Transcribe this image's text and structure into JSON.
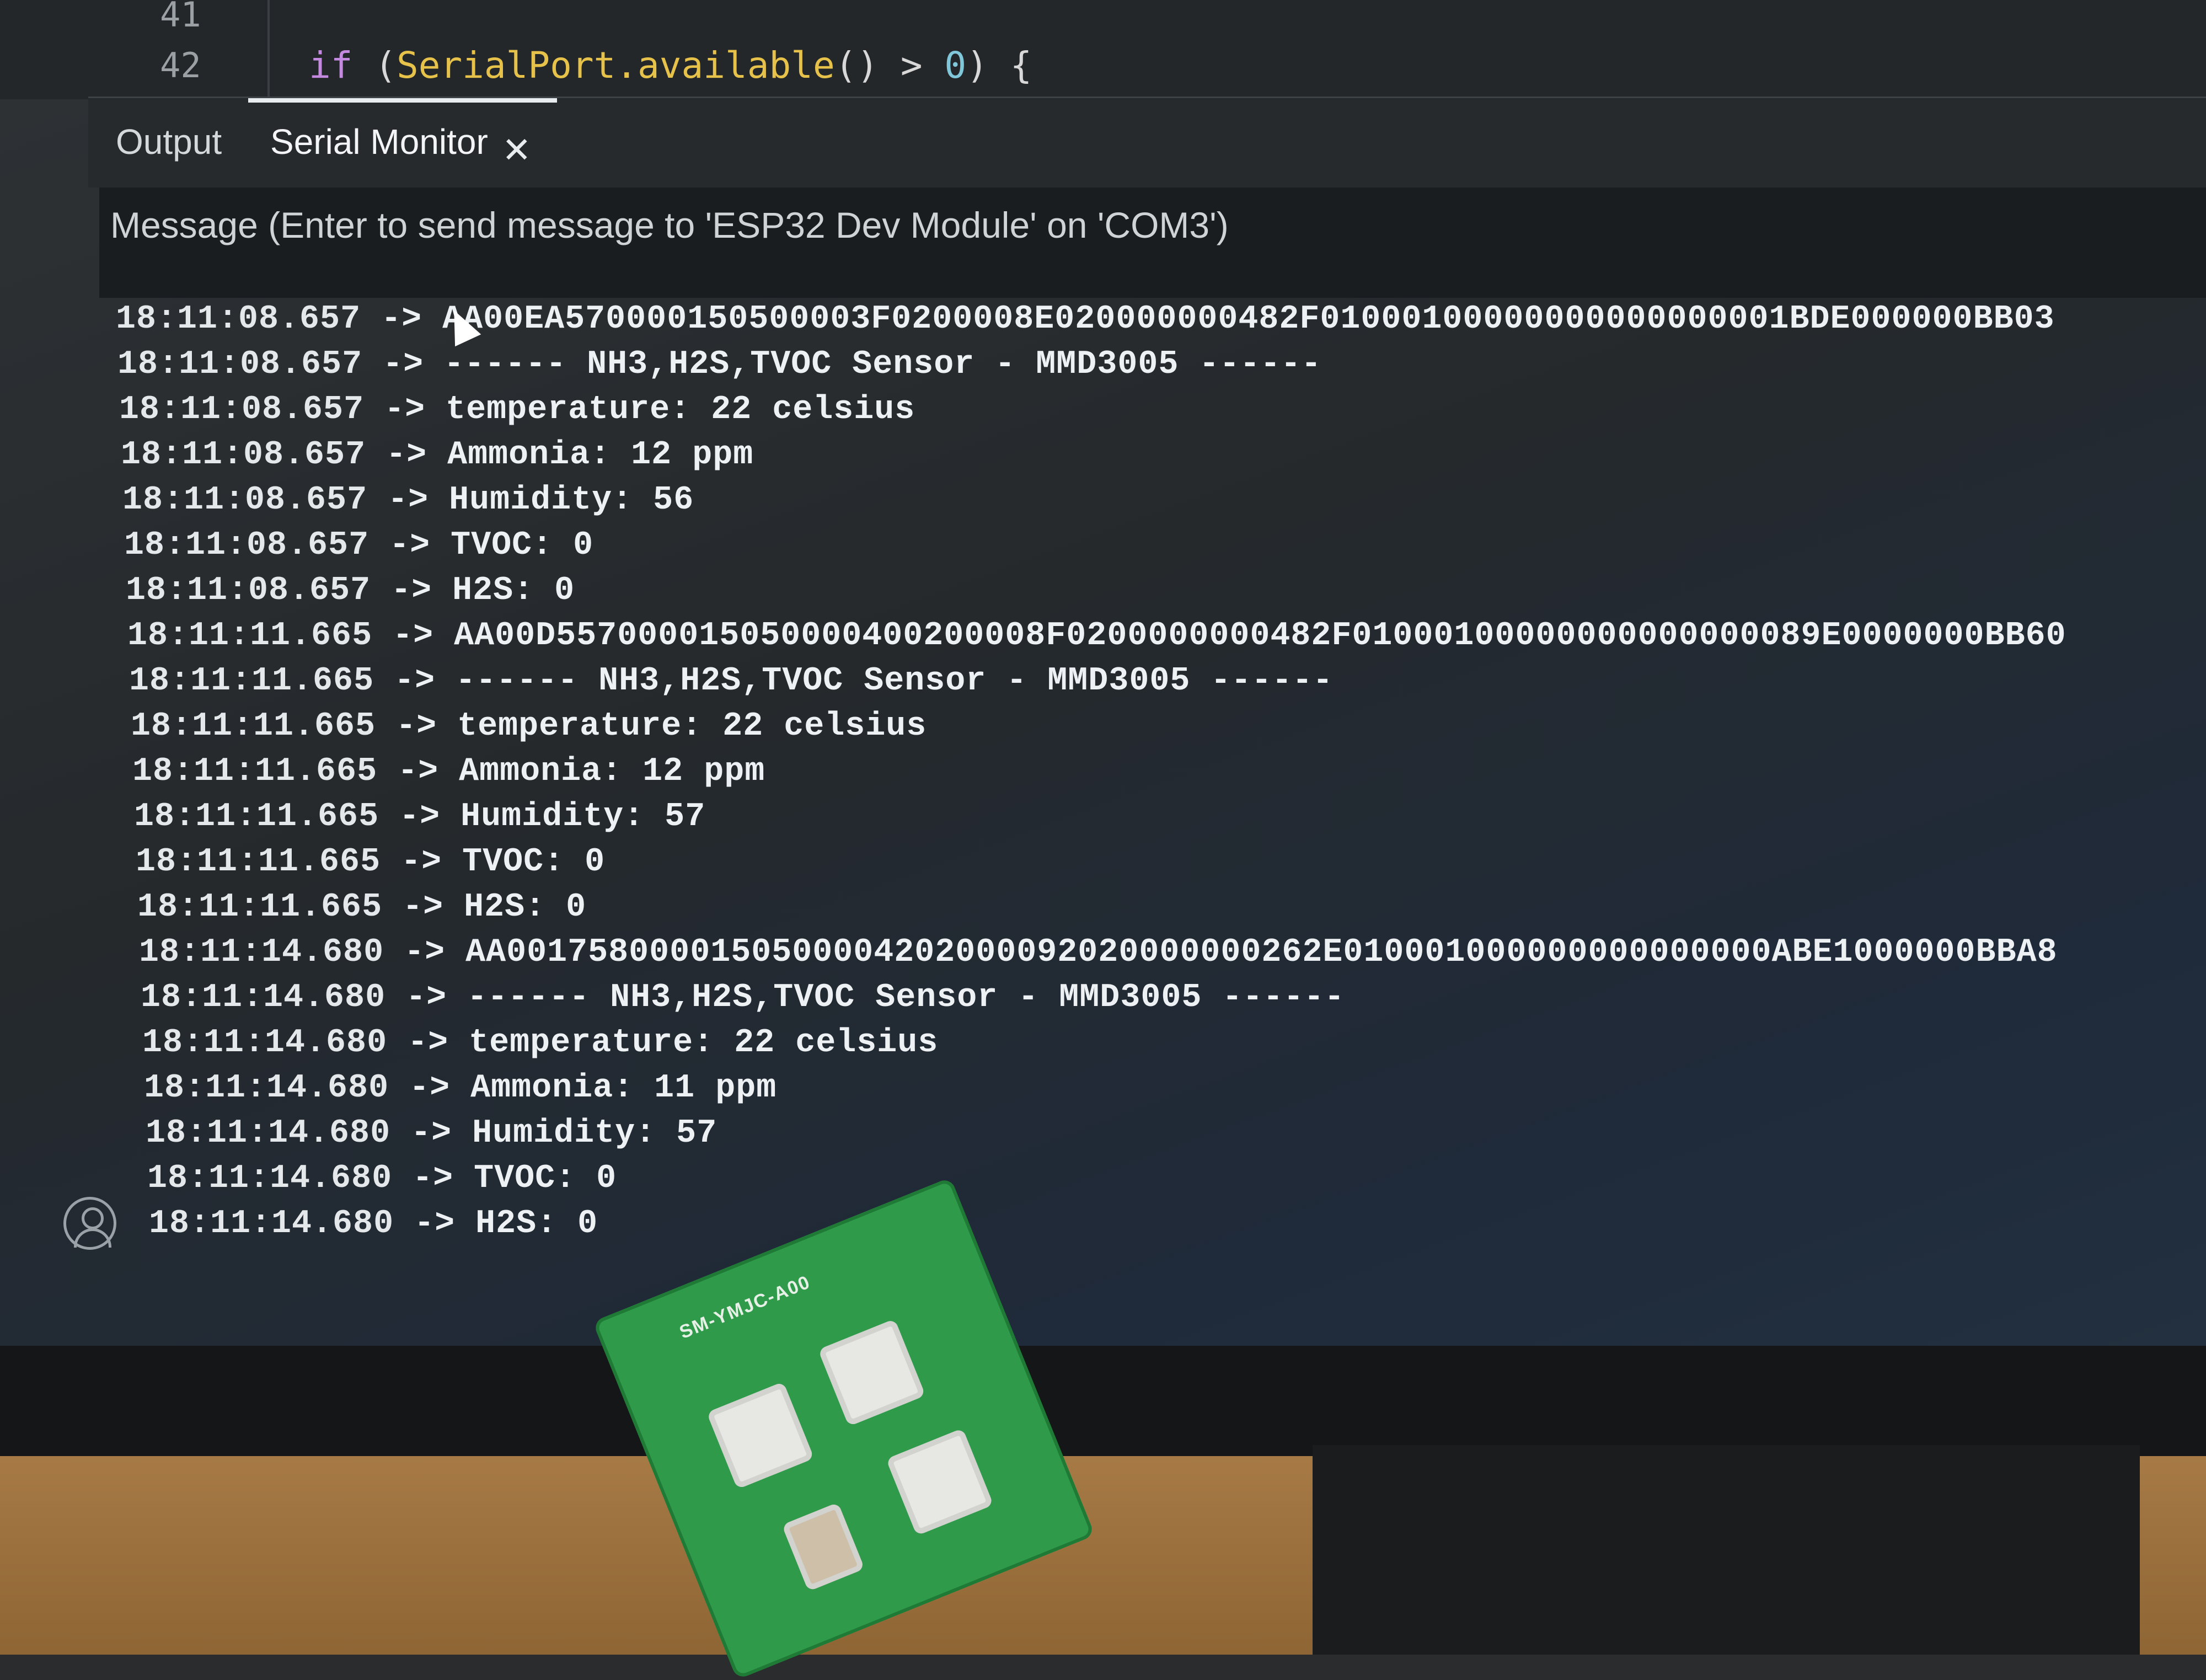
{
  "editor": {
    "lines": [
      {
        "number": "41",
        "code": ""
      },
      {
        "number": "42",
        "code_keyword": "if",
        "code_open": " (",
        "code_fn": "SerialPort.available",
        "code_mid": "() > ",
        "code_num": "0",
        "code_close": ") {"
      }
    ]
  },
  "panel": {
    "tabs": [
      {
        "label": "Output"
      },
      {
        "label": "Serial Monitor"
      }
    ],
    "close_icon": "close-icon",
    "message_placeholder": "Message (Enter to send message to 'ESP32 Dev Module' on 'COM3')"
  },
  "serial_output": [
    {
      "time": "18:11:08.657",
      "text": "AA00EA570000150500003F0200008E020000000482F01000100000000000000001BDE000000BB03"
    },
    {
      "time": "18:11:08.657",
      "text": "------ NH3,H2S,TVOC Sensor - MMD3005 ------"
    },
    {
      "time": "18:11:08.657",
      "text": "temperature: 22 celsius"
    },
    {
      "time": "18:11:08.657",
      "text": "Ammonia: 12 ppm"
    },
    {
      "time": "18:11:08.657",
      "text": "Humidity: 56"
    },
    {
      "time": "18:11:08.657",
      "text": "TVOC: 0"
    },
    {
      "time": "18:11:08.657",
      "text": "H2S: 0"
    },
    {
      "time": "18:11:11.665",
      "text": "AA00D557000015050000400200008F0200000000482F01000100000000000000089E0000000BB60"
    },
    {
      "time": "18:11:11.665",
      "text": "------ NH3,H2S,TVOC Sensor - MMD3005 ------"
    },
    {
      "time": "18:11:11.665",
      "text": "temperature: 22 celsius"
    },
    {
      "time": "18:11:11.665",
      "text": "Ammonia: 12 ppm"
    },
    {
      "time": "18:11:11.665",
      "text": "Humidity: 57"
    },
    {
      "time": "18:11:11.665",
      "text": "TVOC: 0"
    },
    {
      "time": "18:11:11.665",
      "text": "H2S: 0"
    },
    {
      "time": "18:11:14.680",
      "text": "AA0017580000150500004202000092020000000262E010001000000000000000ABE1000000BBA8"
    },
    {
      "time": "18:11:14.680",
      "text": "------ NH3,H2S,TVOC Sensor - MMD3005 ------"
    },
    {
      "time": "18:11:14.680",
      "text": "temperature: 22 celsius"
    },
    {
      "time": "18:11:14.680",
      "text": "Ammonia: 11 ppm"
    },
    {
      "time": "18:11:14.680",
      "text": "Humidity: 57"
    },
    {
      "time": "18:11:14.680",
      "text": "TVOC: 0"
    },
    {
      "time": "18:11:14.680",
      "text": "H2S: 0"
    }
  ],
  "arrow": "->",
  "sidebar": {
    "account_icon": "account-icon"
  },
  "pcb": {
    "label": "SM-YMJC-A00"
  }
}
